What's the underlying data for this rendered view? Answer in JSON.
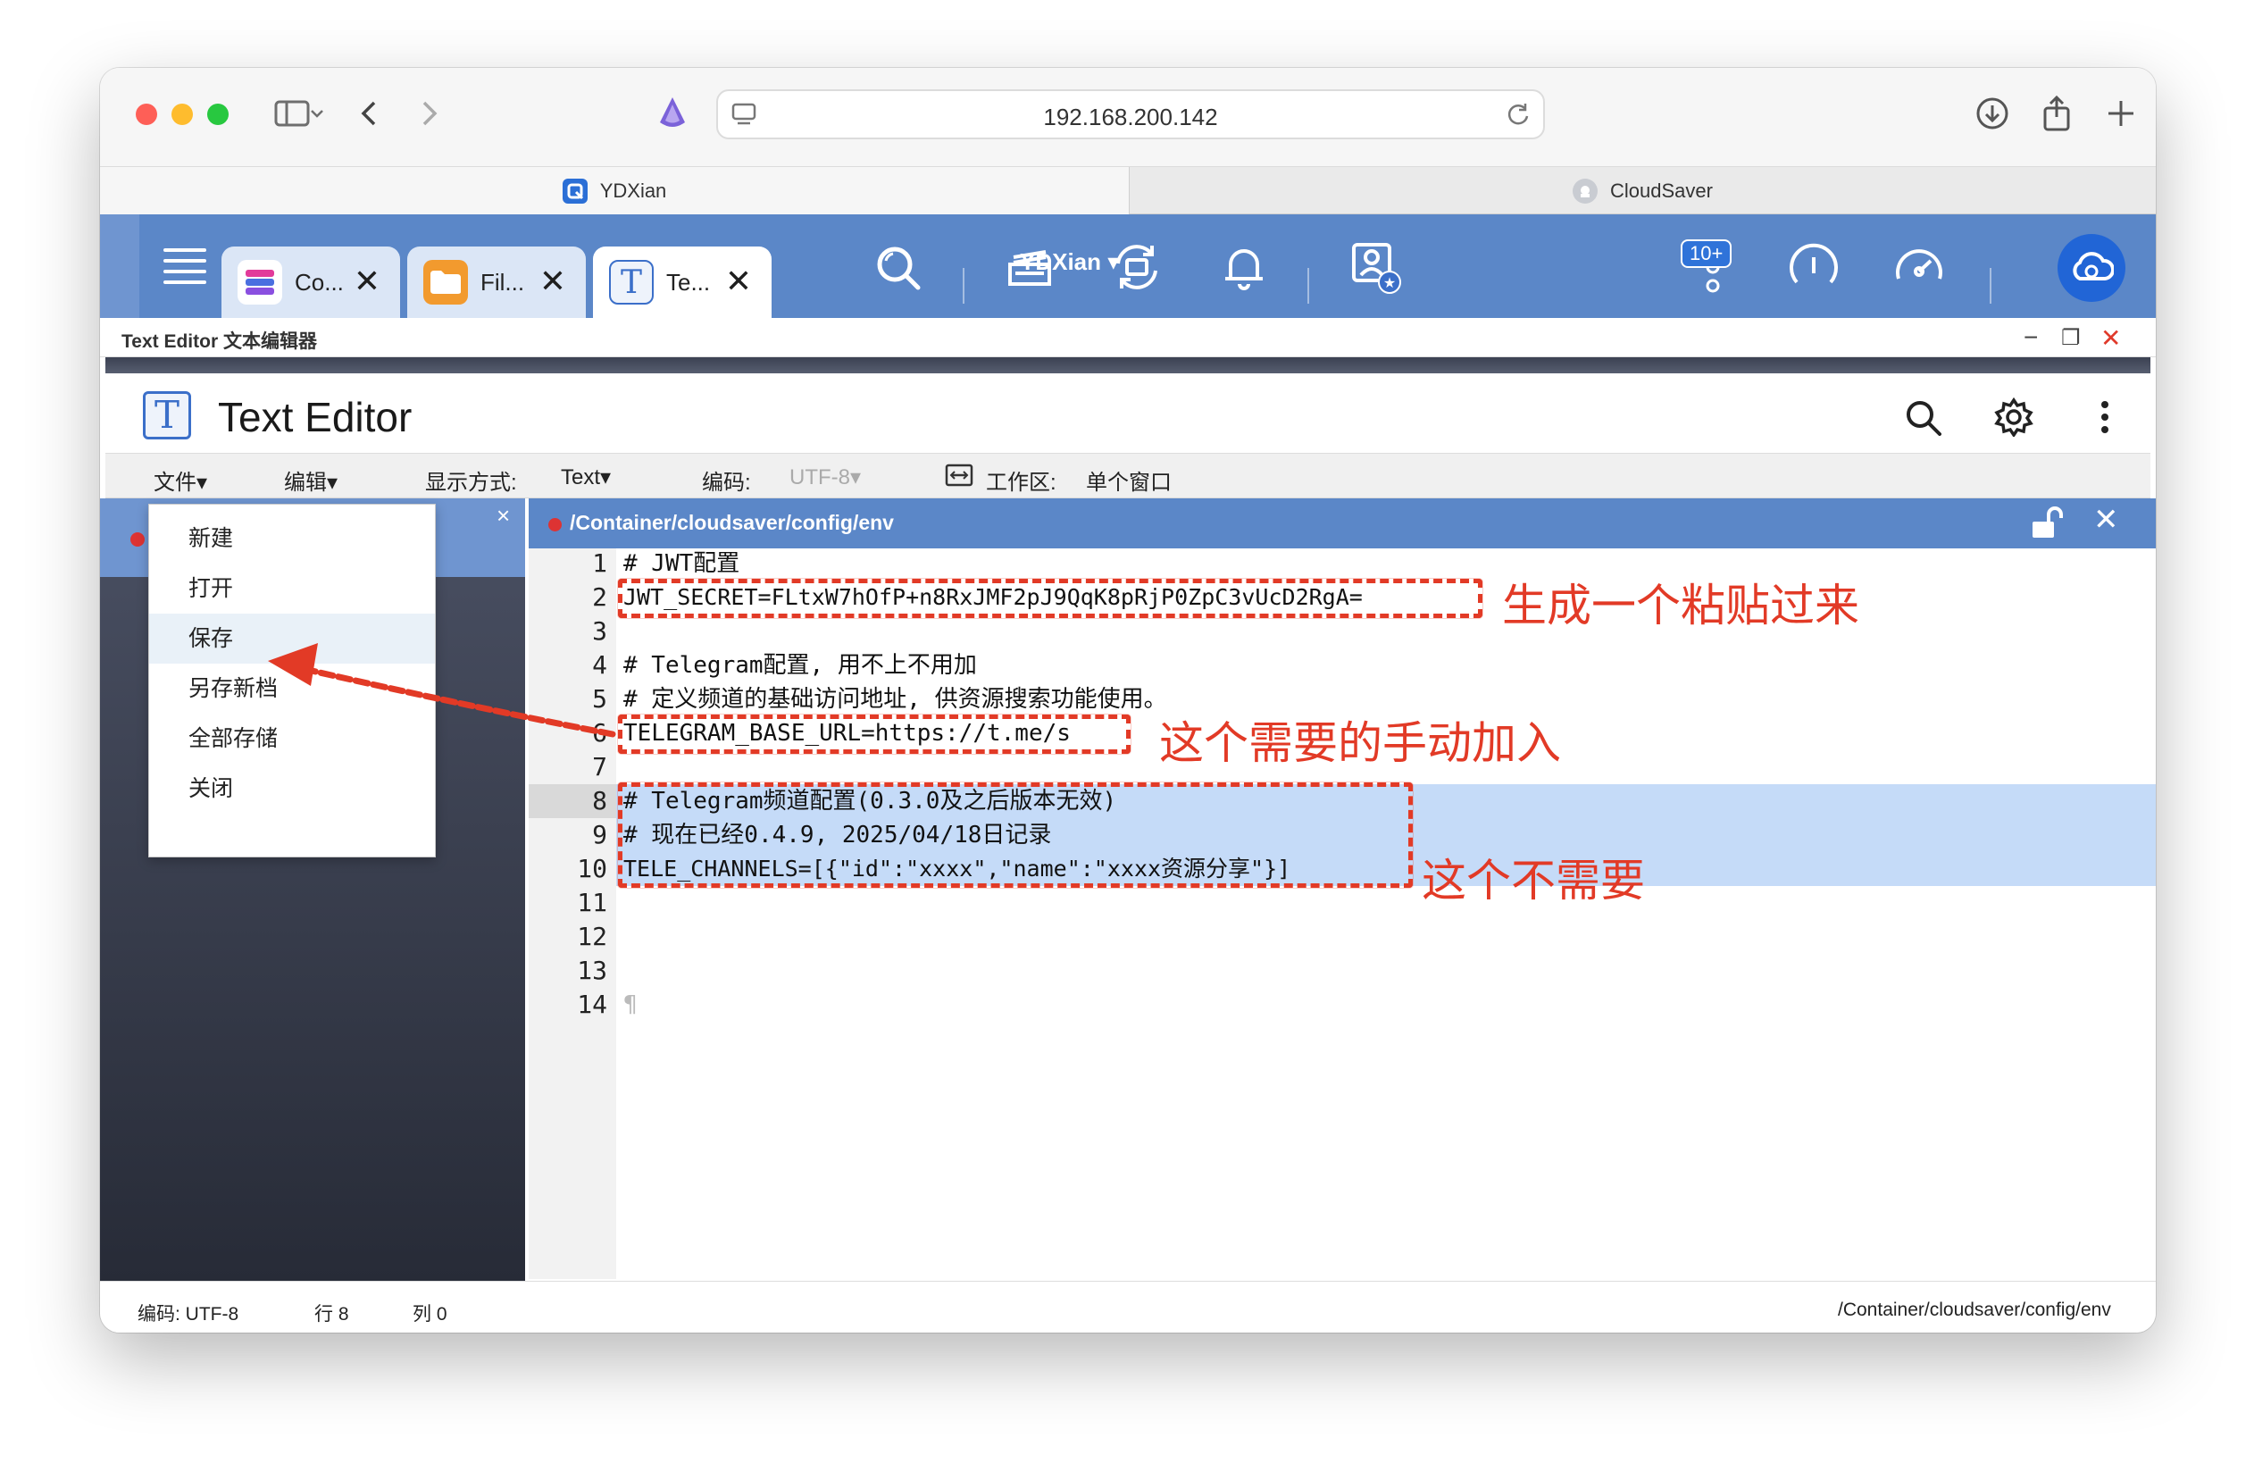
{
  "browser": {
    "url": "192.168.200.142",
    "tabs": [
      {
        "label": "YDXian"
      },
      {
        "label": "CloudSaver"
      }
    ]
  },
  "qnap": {
    "apps": [
      {
        "label": "Co..."
      },
      {
        "label": "Fil..."
      },
      {
        "label": "Te..."
      }
    ],
    "user": "YDXian",
    "badge": "10+"
  },
  "app": {
    "window_title": "Text Editor 文本编辑器",
    "title": "Text Editor",
    "menu": {
      "file": "文件▾",
      "edit": "编辑▾",
      "display_label": "显示方式:",
      "display_value": "Text▾",
      "encoding_label": "编码:",
      "encoding_value": "UTF-8▾",
      "workspace_label": "工作区:",
      "workspace_value": "单个窗口"
    },
    "file_menu": [
      "新建",
      "打开",
      "保存",
      "另存新档",
      "全部存储",
      "关闭"
    ]
  },
  "editor": {
    "path": "/Container/cloudsaver/config/env",
    "lines": [
      {
        "n": "1",
        "text": "# JWT配置"
      },
      {
        "n": "2",
        "text": "JWT_SECRET=FLtxW7hOfP+n8RxJMF2pJ9QqK8pRjP0ZpC3vUcD2RgA="
      },
      {
        "n": "3",
        "text": ""
      },
      {
        "n": "4",
        "text": "# Telegram配置, 用不上不用加"
      },
      {
        "n": "5",
        "text": "# 定义频道的基础访问地址, 供资源搜索功能使用。"
      },
      {
        "n": "6",
        "text": "TELEGRAM_BASE_URL=https://t.me/s"
      },
      {
        "n": "7",
        "text": ""
      },
      {
        "n": "8",
        "text": "# Telegram频道配置(0.3.0及之后版本无效)"
      },
      {
        "n": "9",
        "text": "# 现在已经0.4.9, 2025/04/18日记录"
      },
      {
        "n": "10",
        "text": "TELE_CHANNELS=[{\"id\":\"xxxx\",\"name\":\"xxxx资源分享\"}]"
      },
      {
        "n": "11",
        "text": ""
      },
      {
        "n": "12",
        "text": ""
      },
      {
        "n": "13",
        "text": ""
      },
      {
        "n": "14",
        "text": "¶"
      }
    ]
  },
  "annotations": {
    "a1": "生成一个粘贴过来",
    "a2": "这个需要的手动加入",
    "a3": "这个不需要"
  },
  "status": {
    "encoding": "编码:  UTF-8",
    "row": "行 8",
    "col": "列 0",
    "path": "/Container/cloudsaver/config/env"
  },
  "colors": {
    "qnap_blue": "#5b87c8",
    "annotation_red": "#e23a26",
    "selection": "#c5dbf8"
  }
}
